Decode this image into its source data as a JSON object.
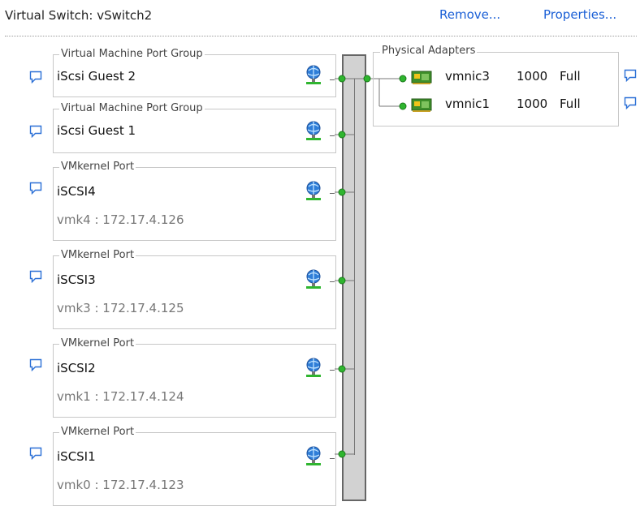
{
  "header": {
    "title": "Virtual Switch: vSwitch2",
    "remove_label": "Remove...",
    "properties_label": "Properties..."
  },
  "port_groups": [
    {
      "type": "Virtual Machine Port Group",
      "name": "iScsi Guest 2",
      "detail": ""
    },
    {
      "type": "Virtual Machine Port Group",
      "name": "iScsi Guest 1",
      "detail": ""
    },
    {
      "type": "VMkernel Port",
      "name": "iSCSI4",
      "detail": "vmk4 : 172.17.4.126"
    },
    {
      "type": "VMkernel Port",
      "name": "iSCSI3",
      "detail": "vmk3 : 172.17.4.125"
    },
    {
      "type": "VMkernel Port",
      "name": "iSCSI2",
      "detail": "vmk1 : 172.17.4.124"
    },
    {
      "type": "VMkernel Port",
      "name": "iSCSI1",
      "detail": "vmk0 : 172.17.4.123"
    }
  ],
  "physical_adapters": {
    "legend": "Physical Adapters",
    "items": [
      {
        "name": "vmnic3",
        "speed": "1000",
        "duplex": "Full"
      },
      {
        "name": "vmnic1",
        "speed": "1000",
        "duplex": "Full"
      }
    ]
  },
  "colors": {
    "link": "#1a5fd6",
    "connector_dot": "#2fb52f",
    "switch_fill": "#d2d2d2"
  },
  "icons": [
    "comment-icon",
    "globe-port-icon",
    "nic-card-icon"
  ]
}
